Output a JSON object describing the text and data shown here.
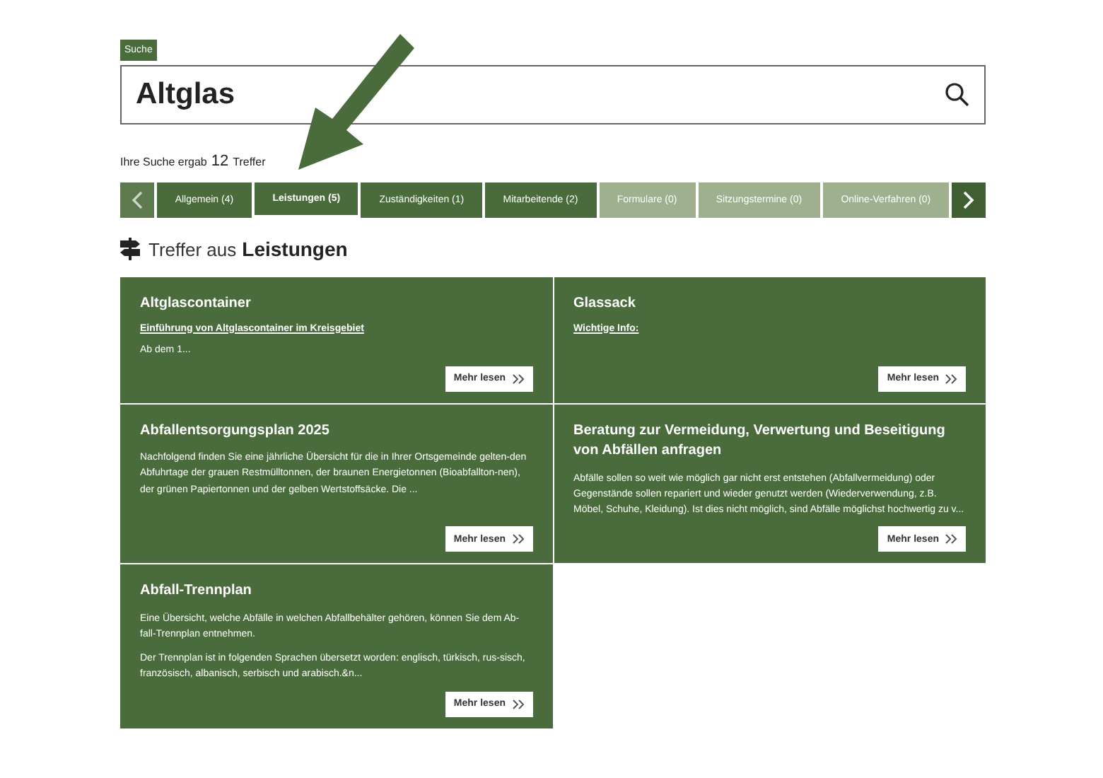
{
  "search": {
    "label": "Suche",
    "value": "Altglas"
  },
  "result_summary": {
    "prefix": "Ihre Suche ergab",
    "count": "12",
    "suffix": "Treffer"
  },
  "tabs": [
    {
      "label": "Allgemein (4)",
      "selected": false,
      "disabled": false
    },
    {
      "label": "Leistungen (5)",
      "selected": true,
      "disabled": false
    },
    {
      "label": "Zuständigkeiten (1)",
      "selected": false,
      "disabled": false
    },
    {
      "label": "Mitarbeitende (2)",
      "selected": false,
      "disabled": false
    },
    {
      "label": "Formulare (0)",
      "selected": false,
      "disabled": true
    },
    {
      "label": "Sitzungstermine (0)",
      "selected": false,
      "disabled": true
    },
    {
      "label": "Online-Verfahren (0)",
      "selected": false,
      "disabled": true
    }
  ],
  "section_heading": {
    "prefix": "Treffer aus",
    "category": "Leistungen"
  },
  "cards": [
    {
      "title": "Altglascontainer",
      "link": "Einführung von Altglascontainer im Kreisgebiet",
      "paragraphs": [
        "Ab dem 1..."
      ],
      "button": "Mehr lesen"
    },
    {
      "title": "Glassack",
      "link": "Wichtige Info:",
      "button": "Mehr lesen"
    },
    {
      "title": "Abfallentsorgungsplan 2025",
      "paragraphs": [
        "Nachfolgend finden Sie eine jährliche Übersicht für die in Ihrer Ortsgemeinde gelten-den Abfuhrtage der grauen Restmülltonnen, der braunen Energietonnen (Bioabfallton-nen), der grünen Papiertonnen und der gelben Wertstoffsäcke. Die ..."
      ],
      "button": "Mehr lesen"
    },
    {
      "title": "Beratung zur Vermeidung, Verwertung und Beseitigung von Abfällen anfragen",
      "paragraphs": [
        "Abfälle sollen so weit wie möglich gar nicht erst entstehen (Abfallvermeidung) oder Gegenstände sollen repariert und wieder genutzt werden (Wiederverwendung, z.B. Möbel, Schuhe, Kleidung). Ist dies nicht möglich, sind Abfälle möglichst hochwertig zu v..."
      ],
      "button": "Mehr lesen"
    },
    {
      "title": "Abfall-Trennplan",
      "paragraphs": [
        "Eine Übersicht, welche Abfälle in welchen Abfallbehälter gehören, können Sie dem Ab-fall-Trennplan entnehmen.",
        "Der Trennplan ist in folgenden Sprachen übersetzt worden: englisch, türkisch, rus-sisch, französisch, albanisch, serbisch und arabisch.&n..."
      ],
      "button": "Mehr lesen"
    }
  ]
}
